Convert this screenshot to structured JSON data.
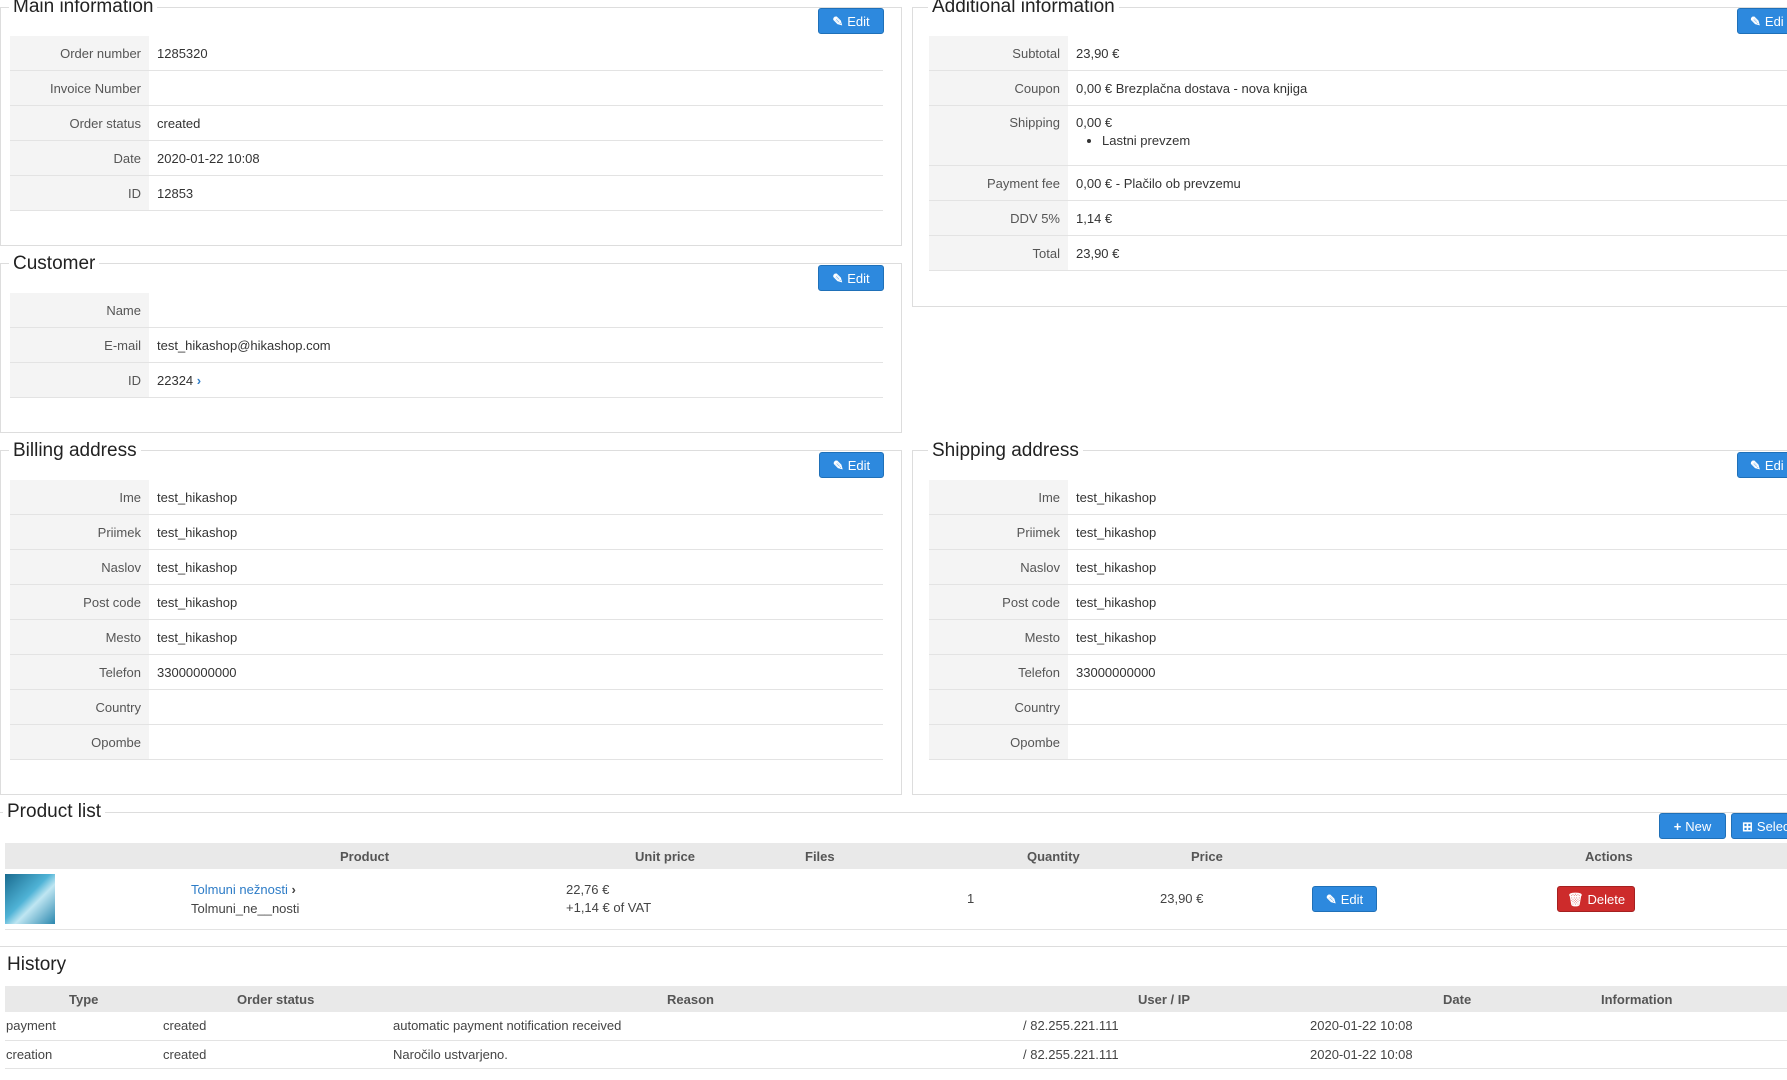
{
  "main_info": {
    "title": "Main information",
    "edit_label": "Edit",
    "rows": [
      {
        "label": "Order number",
        "value": "1285320"
      },
      {
        "label": "Invoice Number",
        "value": ""
      },
      {
        "label": "Order status",
        "value": "created"
      },
      {
        "label": "Date",
        "value": "2020-01-22 10:08"
      },
      {
        "label": "ID",
        "value": "12853"
      }
    ]
  },
  "additional_info": {
    "title": "Additional information",
    "edit_label": "Edi",
    "rows": [
      {
        "label": "Subtotal",
        "value": "23,90 €"
      },
      {
        "label": "Coupon",
        "value": "0,00 € Brezplačna dostava - nova knjiga"
      },
      {
        "label": "Shipping",
        "value": "0,00 €",
        "sub": "Lastni prevzem"
      },
      {
        "label": "Payment fee",
        "value": "0,00 € - Plačilo ob prevzemu"
      },
      {
        "label": "DDV 5%",
        "value": "1,14 €"
      },
      {
        "label": "Total",
        "value": "23,90 €"
      }
    ]
  },
  "customer": {
    "title": "Customer",
    "edit_label": "Edit",
    "rows": [
      {
        "label": "Name",
        "value": ""
      },
      {
        "label": "E-mail",
        "value": "test_hikashop@hikashop.com"
      },
      {
        "label": "ID",
        "value": "22324"
      }
    ]
  },
  "billing": {
    "title": "Billing address",
    "edit_label": "Edit",
    "rows": [
      {
        "label": "Ime",
        "value": "test_hikashop"
      },
      {
        "label": "Priimek",
        "value": "test_hikashop"
      },
      {
        "label": "Naslov",
        "value": "test_hikashop"
      },
      {
        "label": "Post code",
        "value": "test_hikashop"
      },
      {
        "label": "Mesto",
        "value": "test_hikashop"
      },
      {
        "label": "Telefon",
        "value": "33000000000"
      },
      {
        "label": "Country",
        "value": ""
      },
      {
        "label": "Opombe",
        "value": ""
      }
    ]
  },
  "shipping": {
    "title": "Shipping address",
    "edit_label": "Edi",
    "rows": [
      {
        "label": "Ime",
        "value": "test_hikashop"
      },
      {
        "label": "Priimek",
        "value": "test_hikashop"
      },
      {
        "label": "Naslov",
        "value": "test_hikashop"
      },
      {
        "label": "Post code",
        "value": "test_hikashop"
      },
      {
        "label": "Mesto",
        "value": "test_hikashop"
      },
      {
        "label": "Telefon",
        "value": "33000000000"
      },
      {
        "label": "Country",
        "value": ""
      },
      {
        "label": "Opombe",
        "value": ""
      }
    ]
  },
  "products": {
    "title": "Product list",
    "new_label": "New",
    "select_label": "Selec",
    "headers": [
      "Product",
      "Unit price",
      "Files",
      "Quantity",
      "Price",
      "Actions"
    ],
    "item": {
      "name": "Tolmuni nežnosti",
      "code": "Tolmuni_ne__nosti",
      "unit_price": "22,76 €",
      "vat": "+1,14 € of VAT",
      "files": "",
      "quantity": "1",
      "price": "23,90 €",
      "edit_label": "Edit",
      "delete_label": "Delete"
    }
  },
  "history": {
    "title": "History",
    "headers": [
      "Type",
      "Order status",
      "Reason",
      "User / IP",
      "Date",
      "Information"
    ],
    "rows": [
      {
        "type": "payment",
        "status": "created",
        "reason": "automatic payment notification received",
        "user": "/ 82.255.221.111",
        "date": "2020-01-22 10:08",
        "info": ""
      },
      {
        "type": "creation",
        "status": "created",
        "reason": "Naročilo ustvarjeno.",
        "user": "/ 82.255.221.111",
        "date": "2020-01-22 10:08",
        "info": ""
      }
    ]
  },
  "colors": {
    "button_blue": "#2d89de",
    "button_red": "#cd2b2b",
    "link": "#2d7cc7"
  },
  "icons": {
    "edit": "pencil-icon",
    "new": "plus-icon",
    "select": "plus-square-icon",
    "delete": "trash-icon",
    "goto": "chevron-right-icon"
  }
}
